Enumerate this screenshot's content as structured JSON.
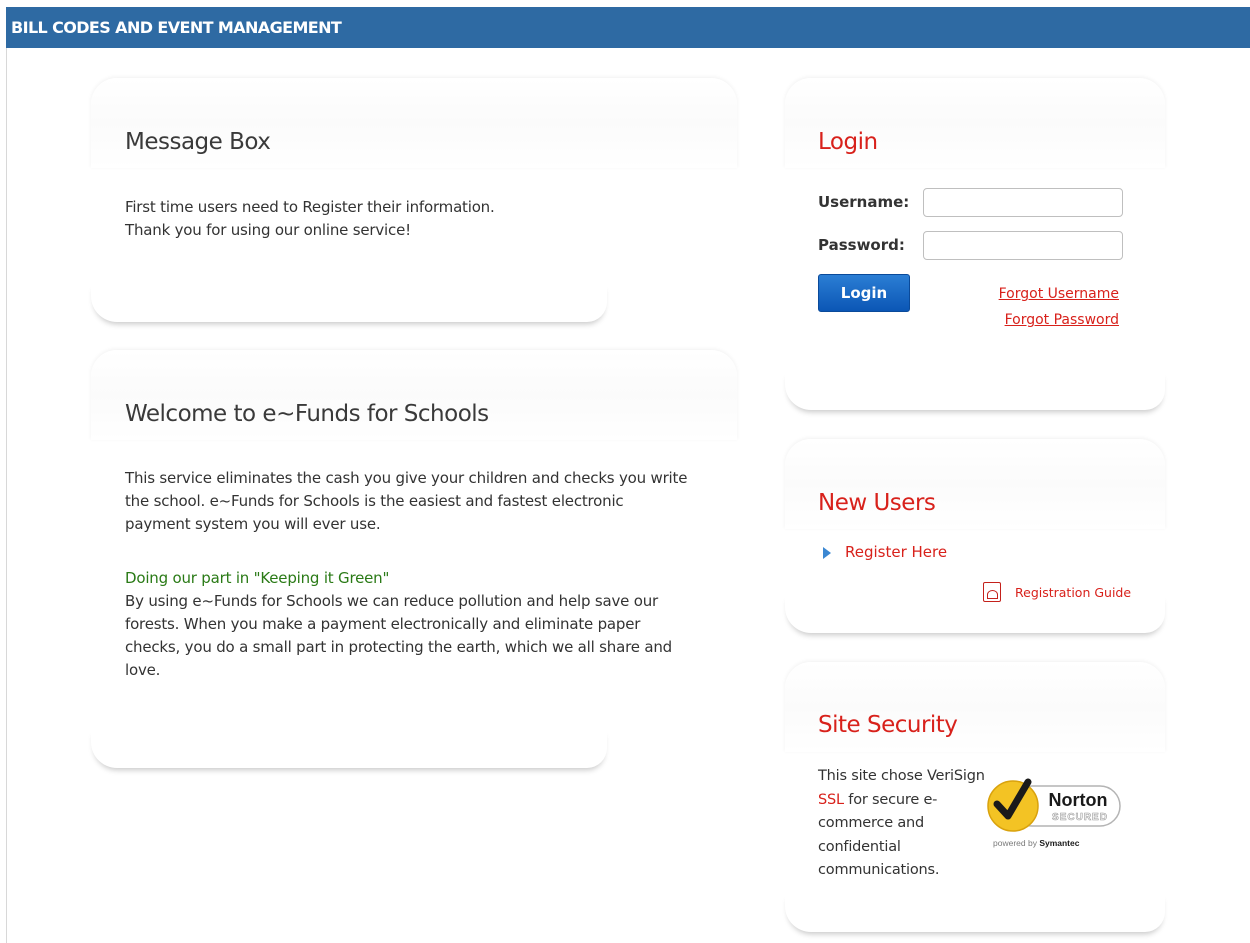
{
  "header": {
    "title": "BILL CODES AND EVENT MANAGEMENT"
  },
  "message_box": {
    "title": "Message Box",
    "line1": "First time users need to Register their information.",
    "line2": "Thank you for using our online service!"
  },
  "welcome": {
    "title": "Welcome to e~Funds for Schools",
    "para1": "This service eliminates the cash you give your children and checks you write the school. e~Funds for Schools is the easiest and fastest electronic payment system you will ever use.",
    "green_heading": "Doing our part in \"Keeping it Green\"",
    "para2": "By using e~Funds for Schools we can reduce pollution and help save our forests. When you make a payment electronically and eliminate paper checks, you do a small part in protecting the earth, which we all share and love."
  },
  "login": {
    "title": "Login",
    "username_label": "Username:",
    "password_label": "Password:",
    "username_value": "",
    "password_value": "",
    "button_label": "Login",
    "forgot_username": "Forgot Username",
    "forgot_password": "Forgot Password"
  },
  "new_users": {
    "title": "New Users",
    "register_link": "Register Here",
    "guide_link": "Registration Guide"
  },
  "security": {
    "title": "Site Security",
    "text_before": "This site chose VeriSign ",
    "ssl_link": "SSL",
    "text_after": " for secure e-commerce and confidential communications.",
    "badge": {
      "word": "Norton",
      "secured": "SECURED",
      "powered_prefix": "powered by ",
      "powered_brand": "Symantec"
    }
  },
  "icons": {
    "register_bullet": "triangle-right-icon",
    "guide": "pdf-icon",
    "badge_check": "checkmark-icon"
  },
  "colors": {
    "header_bg": "#2e6aa3",
    "accent_red": "#d8211b",
    "green_text": "#2a7a16",
    "login_button": "#0b56b5"
  }
}
